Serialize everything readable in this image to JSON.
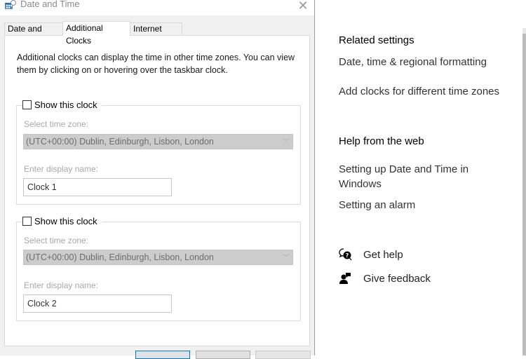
{
  "dialog": {
    "title": "Date and Time",
    "tabs": [
      {
        "label": "Date and Time",
        "active": false
      },
      {
        "label": "Additional Clocks",
        "active": true
      },
      {
        "label": "Internet Time",
        "active": false
      }
    ],
    "description": "Additional clocks can display the time in other time zones. You can view them by clicking on or hovering over the taskbar clock.",
    "clocks": [
      {
        "show_label": "Show this clock",
        "checked": false,
        "timezone_label": "Select time zone:",
        "timezone_value": "(UTC+00:00) Dublin, Edinburgh, Lisbon, London",
        "display_name_label": "Enter display name:",
        "display_name_value": "Clock 1"
      },
      {
        "show_label": "Show this clock",
        "checked": false,
        "timezone_label": "Select time zone:",
        "timezone_value": "(UTC+00:00) Dublin, Edinburgh, Lisbon, London",
        "display_name_label": "Enter display name:",
        "display_name_value": "Clock 2"
      }
    ]
  },
  "settings": {
    "related_title": "Related settings",
    "related_links": [
      "Date, time & regional formatting",
      "Add clocks for different time zones"
    ],
    "help_title": "Help from the web",
    "help_links": [
      "Setting up Date and Time in Windows",
      "Setting an alarm"
    ],
    "actions": [
      {
        "icon": "get-help-icon",
        "label": "Get help"
      },
      {
        "icon": "give-feedback-icon",
        "label": "Give feedback"
      }
    ]
  },
  "colors": {
    "accent": "#0078d7",
    "disabled_select": "#cccccc"
  }
}
